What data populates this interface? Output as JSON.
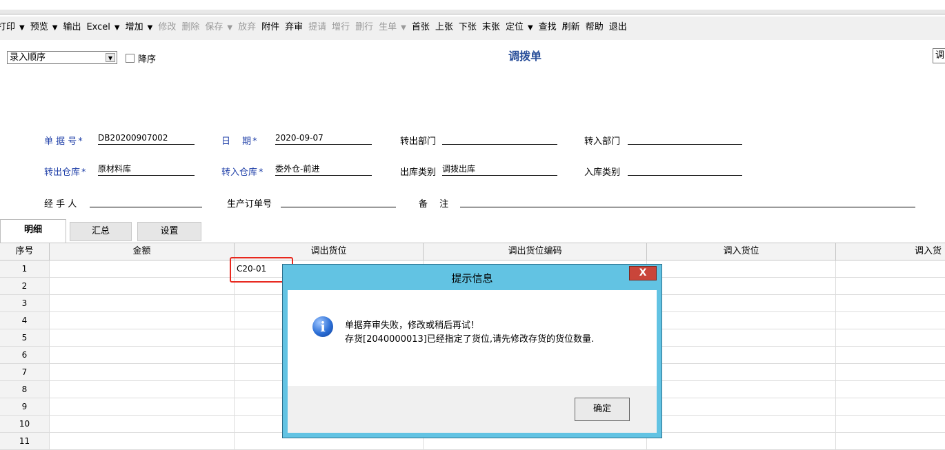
{
  "toolbar": {
    "items": [
      {
        "label": "打印",
        "disabled": false,
        "dropdown": true
      },
      {
        "label": "预览",
        "disabled": false,
        "dropdown": true
      },
      {
        "label": "输出",
        "disabled": false,
        "dropdown": false
      },
      {
        "label": "Excel",
        "disabled": false,
        "dropdown": true
      },
      {
        "label": "增加",
        "disabled": false,
        "dropdown": true
      },
      {
        "label": "修改",
        "disabled": true,
        "dropdown": false
      },
      {
        "label": "删除",
        "disabled": true,
        "dropdown": false
      },
      {
        "label": "保存",
        "disabled": true,
        "dropdown": true
      },
      {
        "label": "放弃",
        "disabled": true,
        "dropdown": false
      },
      {
        "label": "附件",
        "disabled": false,
        "dropdown": false
      },
      {
        "label": "弃审",
        "disabled": false,
        "dropdown": false
      },
      {
        "label": "提请",
        "disabled": true,
        "dropdown": false
      },
      {
        "label": "增行",
        "disabled": true,
        "dropdown": false
      },
      {
        "label": "删行",
        "disabled": true,
        "dropdown": false
      },
      {
        "label": "生单",
        "disabled": true,
        "dropdown": true
      },
      {
        "label": "首张",
        "disabled": false,
        "dropdown": false
      },
      {
        "label": "上张",
        "disabled": false,
        "dropdown": false
      },
      {
        "label": "下张",
        "disabled": false,
        "dropdown": false
      },
      {
        "label": "末张",
        "disabled": false,
        "dropdown": false
      },
      {
        "label": "定位",
        "disabled": false,
        "dropdown": true
      },
      {
        "label": "查找",
        "disabled": false,
        "dropdown": false
      },
      {
        "label": "刷新",
        "disabled": false,
        "dropdown": false
      },
      {
        "label": "帮助",
        "disabled": false,
        "dropdown": false
      },
      {
        "label": "退出",
        "disabled": false,
        "dropdown": false
      }
    ]
  },
  "sort": {
    "selected": "录入顺序",
    "desc_label": "降序",
    "desc_checked": false
  },
  "doc_title": "调拨单",
  "corner_fragment": "调",
  "header": {
    "doc_no_label": "单 据 号",
    "doc_no": "DB20200907002",
    "date_label": "日　 期",
    "date": "2020-09-07",
    "out_dept_label": "转出部门",
    "out_dept": "",
    "in_dept_label": "转入部门",
    "in_dept": "",
    "out_wh_label": "转出仓库",
    "out_wh": "原材料库",
    "in_wh_label": "转入仓库",
    "in_wh": "委外仓-前进",
    "out_type_label": "出库类别",
    "out_type": "调拨出库",
    "in_type_label": "入库类别",
    "in_type": "",
    "handler_label": "经 手 人",
    "handler": "",
    "prod_order_label": "生产订单号",
    "prod_order": "",
    "remark_label": "备　 注",
    "remark": "",
    "required_mark": "*"
  },
  "tabs": [
    "明细",
    "汇总",
    "设置"
  ],
  "grid": {
    "columns": [
      "序号",
      "金额",
      "调出货位",
      "调出货位编码",
      "调入货位",
      "调入货"
    ],
    "rows": [
      {
        "no": "1",
        "amount": "",
        "out_loc": "C20-01"
      },
      {
        "no": "2",
        "amount": "",
        "out_loc": ""
      },
      {
        "no": "3",
        "amount": "",
        "out_loc": ""
      },
      {
        "no": "4",
        "amount": "",
        "out_loc": ""
      },
      {
        "no": "5",
        "amount": "",
        "out_loc": ""
      },
      {
        "no": "6",
        "amount": "",
        "out_loc": ""
      },
      {
        "no": "7",
        "amount": "",
        "out_loc": ""
      },
      {
        "no": "8",
        "amount": "",
        "out_loc": ""
      },
      {
        "no": "9",
        "amount": "",
        "out_loc": ""
      },
      {
        "no": "10",
        "amount": "",
        "out_loc": ""
      },
      {
        "no": "11",
        "amount": "",
        "out_loc": ""
      }
    ]
  },
  "dialog": {
    "title": "提示信息",
    "close": "X",
    "line1": "单据弃审失败，修改或稍后再试！",
    "line2": "存货[2040000013]已经指定了货位,请先修改存货的货位数量.",
    "ok": "确定",
    "icon_glyph": "i"
  },
  "colors": {
    "dialog_frame": "#62c3e3",
    "highlight": "#e8281e",
    "label_blue": "#1f3fa8",
    "title_blue": "#2a4f9a"
  }
}
